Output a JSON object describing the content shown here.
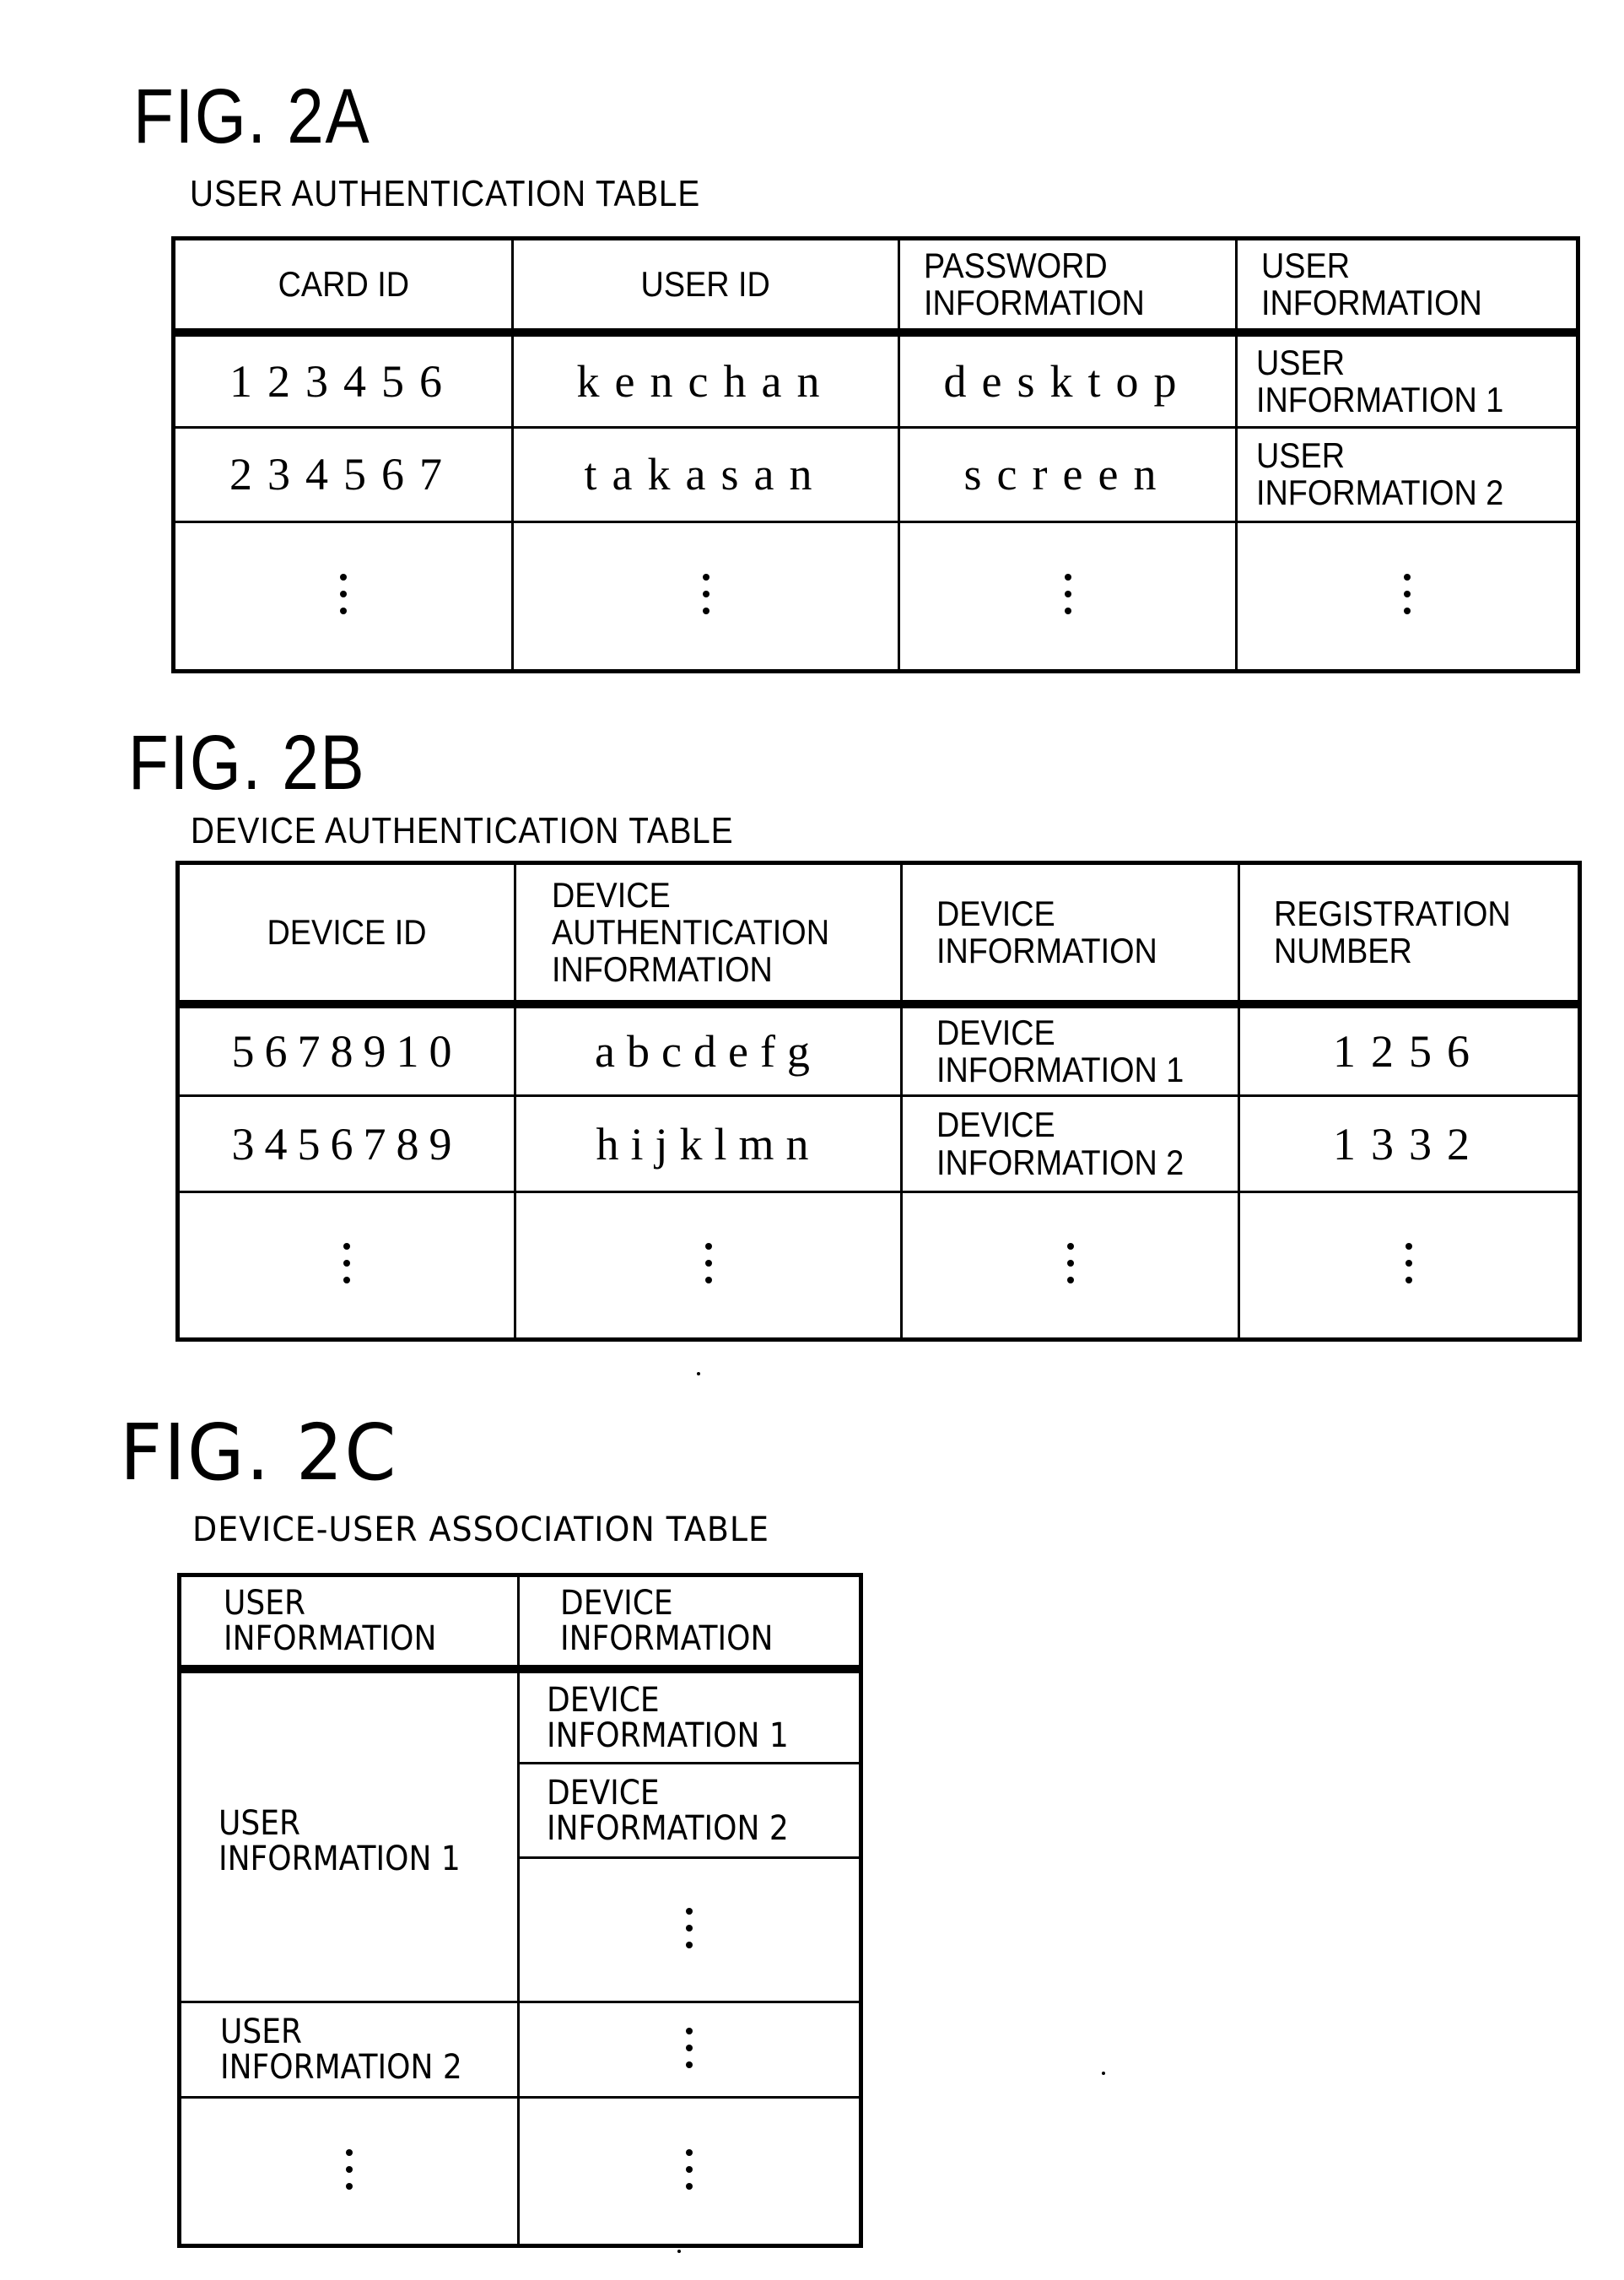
{
  "figures": [
    {
      "figure_label": "FIG. 2A",
      "caption": "USER AUTHENTICATION TABLE",
      "headers": [
        [
          "CARD ID"
        ],
        [
          "USER ID"
        ],
        [
          "PASSWORD",
          "INFORMATION"
        ],
        [
          "USER",
          "INFORMATION"
        ]
      ],
      "rows": [
        {
          "card_id": "123456",
          "user_id": "kenchan",
          "password": "desktop",
          "user_info": [
            "USER",
            "INFORMATION 1"
          ]
        },
        {
          "card_id": "234567",
          "user_id": "takasan",
          "password": "screen",
          "user_info": [
            "USER",
            "INFORMATION 2"
          ]
        }
      ],
      "continuation": "⋮"
    },
    {
      "figure_label": "FIG. 2B",
      "caption": "DEVICE AUTHENTICATION TABLE",
      "headers": [
        [
          "DEVICE ID"
        ],
        [
          "DEVICE",
          "AUTHENTICATION",
          "INFORMATION"
        ],
        [
          "DEVICE",
          "INFORMATION"
        ],
        [
          "REGISTRATION",
          "NUMBER"
        ]
      ],
      "rows": [
        {
          "device_id": "5678910",
          "auth_info": "abcdefg",
          "device_info": [
            "DEVICE",
            "INFORMATION 1"
          ],
          "registration_number": "1256"
        },
        {
          "device_id": "3456789",
          "auth_info": "hijklmn",
          "device_info": [
            "DEVICE",
            "INFORMATION 2"
          ],
          "registration_number": "1332"
        }
      ],
      "continuation": "⋮"
    },
    {
      "figure_label": "FIG. 2C",
      "caption": "DEVICE-USER ASSOCIATION TABLE",
      "headers": [
        [
          "USER",
          "INFORMATION"
        ],
        [
          "DEVICE",
          "INFORMATION"
        ]
      ],
      "groups": [
        {
          "user_info": [
            "USER",
            "INFORMATION 1"
          ],
          "devices": [
            [
              "DEVICE",
              "INFORMATION 1"
            ],
            [
              "DEVICE",
              "INFORMATION 2"
            ]
          ],
          "more_devices": true
        },
        {
          "user_info": [
            "USER",
            "INFORMATION 2"
          ],
          "devices": [],
          "more_devices": true
        }
      ],
      "continuation": "⋮"
    }
  ]
}
